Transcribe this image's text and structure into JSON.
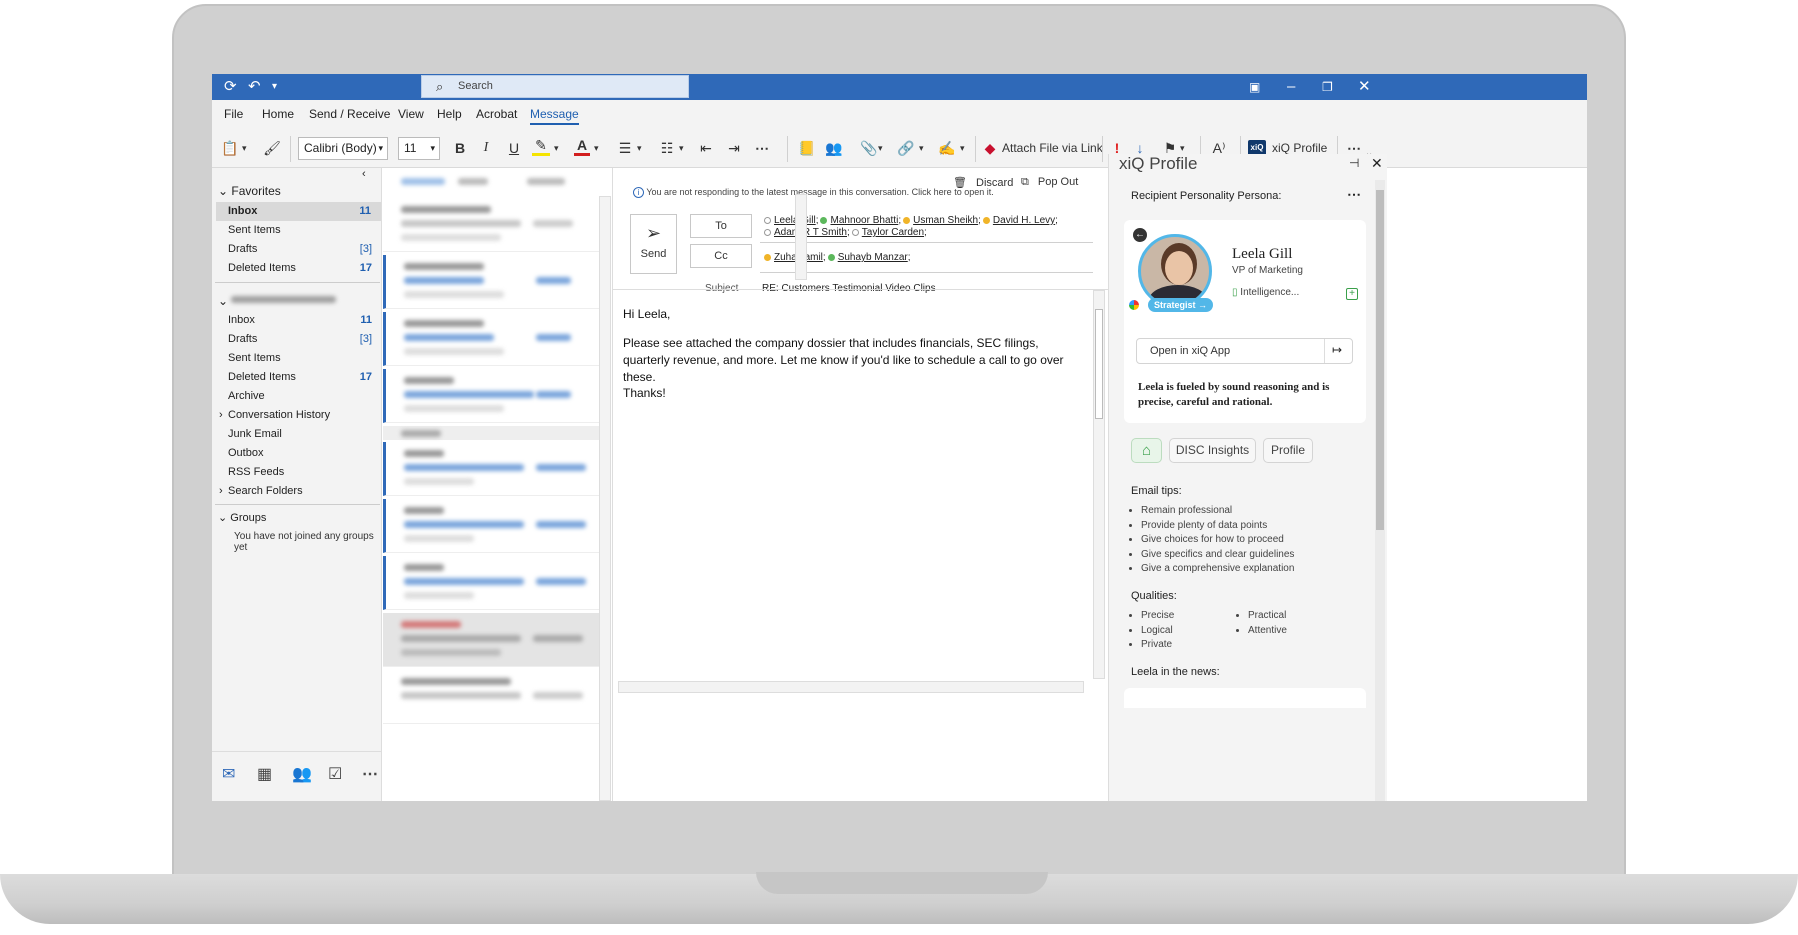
{
  "search": {
    "placeholder": "Search"
  },
  "menu": [
    "File",
    "Home",
    "Send / Receive",
    "View",
    "Help",
    "Acrobat",
    "Message"
  ],
  "ribbon": {
    "font_name": "Calibri (Body)",
    "font_size": "11",
    "attach_link": "Attach File via Link",
    "xiq_profile": "xiQ Profile"
  },
  "nav": {
    "favorites": "Favorites",
    "fav_items": [
      {
        "label": "Inbox",
        "count": "11"
      },
      {
        "label": "Sent Items",
        "count": ""
      },
      {
        "label": "Drafts",
        "count": "[3]"
      },
      {
        "label": "Deleted Items",
        "count": "17"
      }
    ],
    "account_items": [
      {
        "label": "Inbox",
        "count": "11"
      },
      {
        "label": "Drafts",
        "count": "[3]"
      },
      {
        "label": "Sent Items",
        "count": ""
      },
      {
        "label": "Deleted Items",
        "count": "17"
      },
      {
        "label": "Archive",
        "count": ""
      },
      {
        "label": "Conversation History",
        "count": ""
      },
      {
        "label": "Junk Email",
        "count": ""
      },
      {
        "label": "Outbox",
        "count": ""
      },
      {
        "label": "RSS Feeds",
        "count": ""
      },
      {
        "label": "Search Folders",
        "count": ""
      }
    ],
    "groups": "Groups",
    "groups_empty": "You have not joined any groups yet"
  },
  "compose": {
    "discard": "Discard",
    "popout": "Pop Out",
    "info": "You are not responding to the latest message in this conversation. Click here to open it.",
    "send": "Send",
    "to_label": "To",
    "cc_label": "Cc",
    "subject_label": "Subject",
    "subject": "RE: Customers Testimonial Video Clips",
    "to": [
      {
        "name": "Leela Gill",
        "status": "#ffffff"
      },
      {
        "name": "Mahnoor Bhatti",
        "status": "#5cb85c"
      },
      {
        "name": "Usman Sheikh",
        "status": "#f0b429"
      },
      {
        "name": "David H. Levy",
        "status": "#f0b429"
      },
      {
        "name": "Adam R T Smith",
        "status": "#ffffff"
      },
      {
        "name": "Taylor Carden",
        "status": "#ffffff"
      }
    ],
    "cc": [
      {
        "name": "Zuha Jamil",
        "status": "#f0b429"
      },
      {
        "name": "Suhayb Manzar",
        "status": "#5cb85c"
      }
    ],
    "greeting": "Hi Leela,",
    "body": "Please see attached the company dossier that includes financials, SEC filings, quarterly revenue, and more. Let me know if you'd like to schedule a call to go over these.",
    "closing": "Thanks!"
  },
  "xiq": {
    "title": "xiQ Profile",
    "persona_label": "Recipient Personality Persona:",
    "name": "Leela Gill",
    "role": "VP of Marketing",
    "badge": "Strategist →",
    "company": "Intelligence...",
    "open_app": "Open in xiQ App",
    "summary": "Leela is fueled by sound reasoning and is precise, careful and rational.",
    "tabs": [
      "DISC Insights",
      "Profile"
    ],
    "email_tips_label": "Email tips:",
    "email_tips": [
      "Remain professional",
      "Provide plenty of data points",
      "Give choices for how to proceed",
      "Give specifics and clear guidelines",
      "Give a comprehensive explanation"
    ],
    "qualities_label": "Qualities:",
    "qualities_left": [
      "Precise",
      "Logical",
      "Private"
    ],
    "qualities_right": [
      "Practical",
      "Attentive"
    ],
    "news_label": "Leela in the news:"
  },
  "colors": {
    "accent": "#2f69b8",
    "avatar_ring": "#52b7e8",
    "alert": "#e02020"
  }
}
